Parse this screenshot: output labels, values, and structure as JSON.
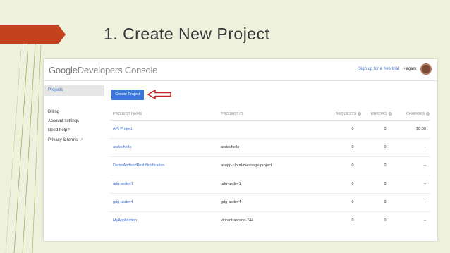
{
  "slide": {
    "title": "1. Create New Project",
    "accent_color": "#c4421e"
  },
  "console": {
    "logo": {
      "brand": "Google",
      "product": "Developers Console"
    },
    "signup_link": "Sign up for a free trial",
    "user_label": "+agam",
    "sidebar": [
      {
        "label": "Projects",
        "active": true
      },
      {
        "label": "Billing"
      },
      {
        "label": "Account settings"
      },
      {
        "label": "Need help?"
      },
      {
        "label": "Privacy & terms",
        "icon": "external-link-icon"
      }
    ],
    "create_button": "Create Project",
    "table": {
      "headers": {
        "name": "PROJECT NAME",
        "id": "PROJECT ID",
        "requests": "REQUESTS",
        "errors": "ERRORS",
        "charges": "CHARGES"
      },
      "help_glyph": "?",
      "rows": [
        {
          "name": "API Project",
          "id": "",
          "requests": "0",
          "errors": "0",
          "charges": "$0.00"
        },
        {
          "name": "asdevhello",
          "id": "asdevhello",
          "requests": "0",
          "errors": "0",
          "charges": "–"
        },
        {
          "name": "DemoAndroidPushNotification",
          "id": "asapp-cloud-message-project",
          "requests": "0",
          "errors": "0",
          "charges": "–"
        },
        {
          "name": "gdg-asdev1",
          "id": "gdg-asdev1",
          "requests": "0",
          "errors": "0",
          "charges": "–"
        },
        {
          "name": "gdg-asdev4",
          "id": "gdg-asdev4",
          "requests": "0",
          "errors": "0",
          "charges": "–"
        },
        {
          "name": "MyApplication",
          "id": "vibrant-arcana-744",
          "requests": "0",
          "errors": "0",
          "charges": "–"
        }
      ]
    }
  }
}
